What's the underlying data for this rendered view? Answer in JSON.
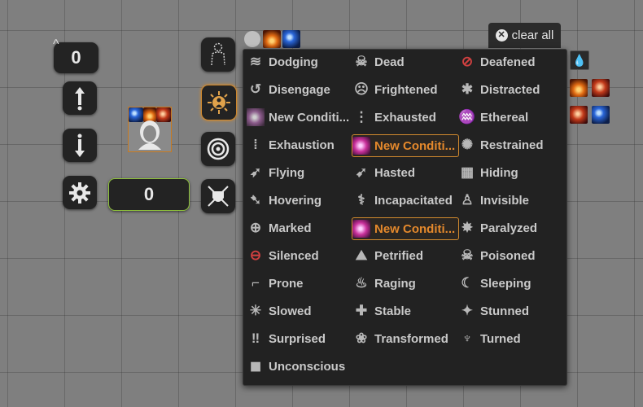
{
  "left_toolbar": {
    "top_counter_value": "0",
    "top_counter_caret": "^",
    "bottom_counter_value": "0"
  },
  "clear_all": {
    "label": "clear all",
    "icon": "x-circle-icon"
  },
  "conditions": [
    {
      "label": "Dodging",
      "icon": "dodging-icon",
      "selected": false
    },
    {
      "label": "Dead",
      "icon": "skull-icon",
      "selected": false
    },
    {
      "label": "Deafened",
      "icon": "deafened-icon",
      "selected": false
    },
    {
      "label": "Disengage",
      "icon": "disengage-icon",
      "selected": false
    },
    {
      "label": "Frightened",
      "icon": "frightened-icon",
      "selected": false
    },
    {
      "label": "Distracted",
      "icon": "distracted-icon",
      "selected": false
    },
    {
      "label": "New Conditi...",
      "icon": "custom-condition-icon",
      "selected": false
    },
    {
      "label": "Exhausted",
      "icon": "exhausted-icon",
      "selected": false
    },
    {
      "label": "Ethereal",
      "icon": "ethereal-icon",
      "selected": false
    },
    {
      "label": "Exhaustion",
      "icon": "exhaustion-icon",
      "selected": false
    },
    {
      "label": "New Conditi...",
      "icon": "custom-condition-icon",
      "selected": true
    },
    {
      "label": "Restrained",
      "icon": "web-icon",
      "selected": false
    },
    {
      "label": "Flying",
      "icon": "wing-icon",
      "selected": false
    },
    {
      "label": "Hasted",
      "icon": "winged-boot-icon",
      "selected": false
    },
    {
      "label": "Hiding",
      "icon": "hiding-icon",
      "selected": false
    },
    {
      "label": "Hovering",
      "icon": "hovering-wing-icon",
      "selected": false
    },
    {
      "label": "Incapacitated",
      "icon": "incapacitated-icon",
      "selected": false
    },
    {
      "label": "Invisible",
      "icon": "invisible-icon",
      "selected": false
    },
    {
      "label": "Marked",
      "icon": "crosshair-icon",
      "selected": false
    },
    {
      "label": "New Conditi...",
      "icon": "custom-condition-icon",
      "selected": true
    },
    {
      "label": "Paralyzed",
      "icon": "paralyzed-icon",
      "selected": false
    },
    {
      "label": "Silenced",
      "icon": "silenced-icon",
      "selected": false
    },
    {
      "label": "Petrified",
      "icon": "petrified-icon",
      "selected": false
    },
    {
      "label": "Poisoned",
      "icon": "poison-icon",
      "selected": false
    },
    {
      "label": "Prone",
      "icon": "prone-icon",
      "selected": false
    },
    {
      "label": "Raging",
      "icon": "raging-icon",
      "selected": false
    },
    {
      "label": "Sleeping",
      "icon": "sleeping-icon",
      "selected": false
    },
    {
      "label": "Slowed",
      "icon": "slowed-icon",
      "selected": false
    },
    {
      "label": "Stable",
      "icon": "stable-icon",
      "selected": false
    },
    {
      "label": "Stunned",
      "icon": "stunned-icon",
      "selected": false
    },
    {
      "label": "Surprised",
      "icon": "surprised-icon",
      "selected": false
    },
    {
      "label": "Transformed",
      "icon": "paw-icon",
      "selected": false
    },
    {
      "label": "Turned",
      "icon": "turned-icon",
      "selected": false
    },
    {
      "label": "Unconscious",
      "icon": "unconscious-icon",
      "selected": false
    }
  ],
  "colors": {
    "menu_bg": "#222222",
    "selected_accent": "#e5892c",
    "token_border": "#c77a20",
    "counter_border": "#8fc43a"
  }
}
